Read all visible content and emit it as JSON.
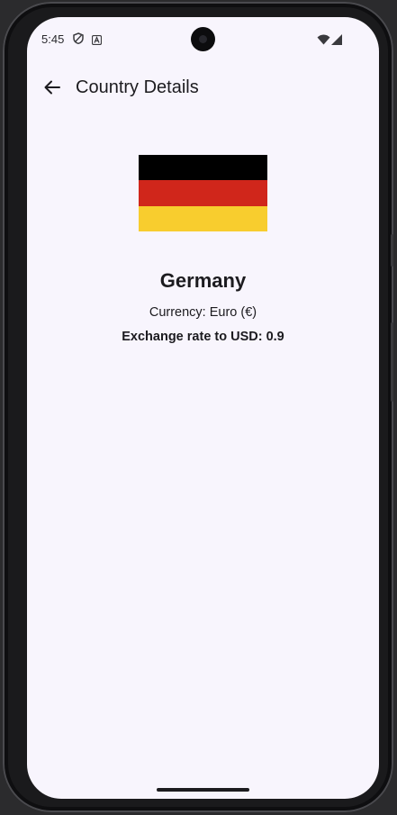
{
  "status_bar": {
    "time": "5:45",
    "icons": [
      "shield-icon",
      "a-badge-icon",
      "wifi-icon",
      "signal-icon"
    ]
  },
  "app_bar": {
    "back_icon": "arrow-back-icon",
    "title": "Country Details"
  },
  "country": {
    "flag": {
      "icon": "germany-flag",
      "colors": [
        "#000000",
        "#d0261b",
        "#f8cd2e"
      ]
    },
    "name": "Germany",
    "currency": "Currency: Euro (€)",
    "exchange_rate": "Exchange rate to USD: 0.9"
  },
  "colors": {
    "background": "#f8f5fd",
    "text": "#1c1b1f"
  }
}
